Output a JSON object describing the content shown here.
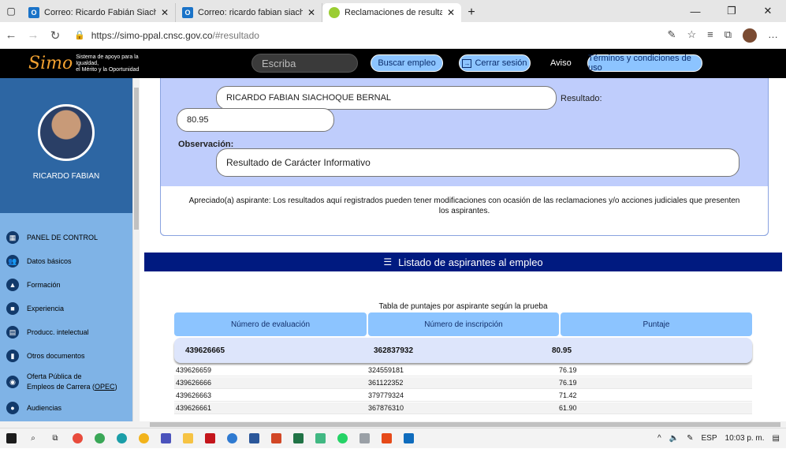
{
  "browser": {
    "tabs": [
      {
        "label": "Correo: Ricardo Fabián Siachoque",
        "icon": "outlook-icon"
      },
      {
        "label": "Correo: ricardo fabian siachoque",
        "icon": "outlook-icon"
      },
      {
        "label": "Reclamaciones de resultados",
        "icon": "leaf-icon"
      }
    ],
    "url_prefix": "https://simo-ppal.cnsc.gov.co",
    "url_path": "/#resultado"
  },
  "header": {
    "logo_mark": "Simo",
    "logo_line1": "Sistema de apoyo para la Igualdad,",
    "logo_line2": "el Mérito y la Oportunidad",
    "search_placeholder": "Escriba",
    "buscar_label": "Buscar empleo",
    "cerrar_label": "Cerrar sesión",
    "aviso_label": "Aviso",
    "terminos_label": "Términos y condiciones de uso"
  },
  "sidebar": {
    "user_name": "RICARDO FABIAN",
    "items": [
      {
        "label": "PANEL DE CONTROL",
        "icon": "dashboard-icon"
      },
      {
        "label": "Datos básicos",
        "icon": "users-icon"
      },
      {
        "label": "Formación",
        "icon": "graduation-icon"
      },
      {
        "label": "Experiencia",
        "icon": "briefcase-icon"
      },
      {
        "label": "Producc. intelectual",
        "icon": "book-icon"
      },
      {
        "label": "Otros documentos",
        "icon": "document-icon"
      },
      {
        "label": "Oferta Pública de",
        "icon": "globe-icon",
        "line2_prefix": "Empleos de Carrera (",
        "line2_link": "OPEC",
        "line2_suffix": ")"
      },
      {
        "label": "Audiencias",
        "icon": "audience-icon"
      }
    ]
  },
  "result": {
    "name_value": "RICARDO FABIAN SIACHOQUE BERNAL",
    "resultado_label": "Resultado:",
    "resultado_value": "80.95",
    "observacion_label": "Observación:",
    "observacion_value": "Resultado de Carácter Informativo",
    "notice_line1": "Apreciado(a) aspirante: Los resultados aquí registrados pueden tener modificaciones con ocasión de las reclamaciones y/o acciones judiciales que presenten",
    "notice_line2": "los aspirantes."
  },
  "list": {
    "title": "Listado de aspirantes al empleo",
    "caption": "Tabla de puntajes por aspirante según la prueba",
    "columns": [
      "Número de evaluación",
      "Número de inscripción",
      "Puntaje"
    ],
    "highlight": {
      "evaluacion": "439626665",
      "inscripcion": "362837932",
      "puntaje": "80.95"
    },
    "rows": [
      {
        "evaluacion": "439626659",
        "inscripcion": "324559181",
        "puntaje": "76.19"
      },
      {
        "evaluacion": "439626666",
        "inscripcion": "361122352",
        "puntaje": "76.19"
      },
      {
        "evaluacion": "439626663",
        "inscripcion": "379779324",
        "puntaje": "71.42"
      },
      {
        "evaluacion": "439626661",
        "inscripcion": "367876310",
        "puntaje": "61.90"
      }
    ]
  },
  "taskbar": {
    "lang": "ESP",
    "time": "10:03 p. m."
  }
}
